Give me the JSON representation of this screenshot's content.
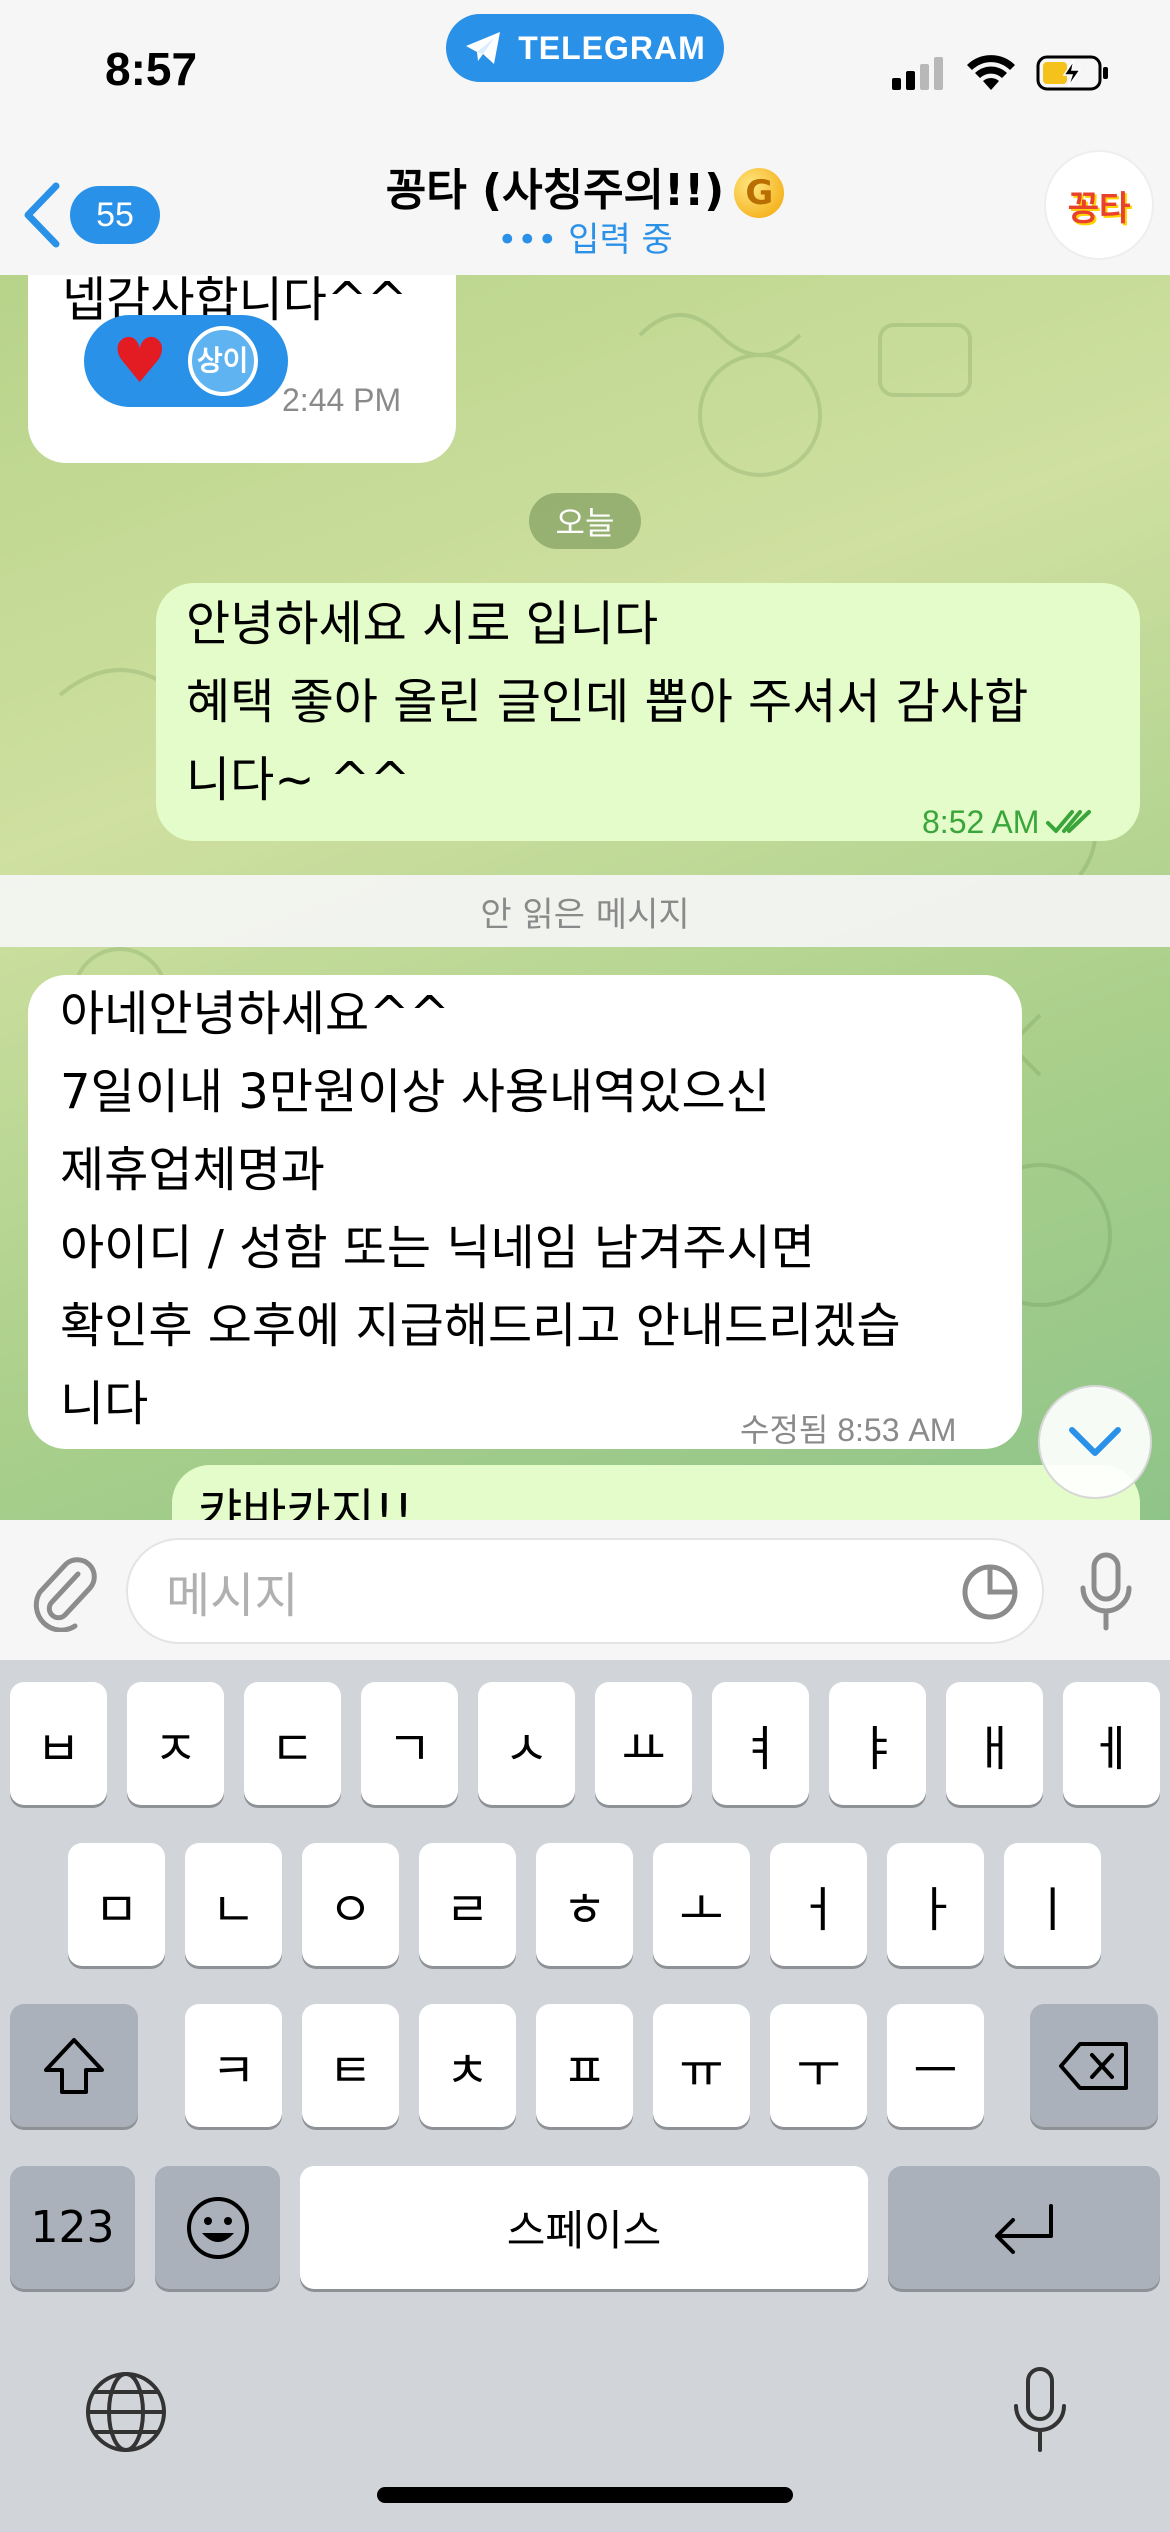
{
  "status": {
    "time": "8:57",
    "app_pill": "TELEGRAM"
  },
  "header": {
    "back_count": "55",
    "title": "꽁타 (사칭주의!!)",
    "title_badge": "G",
    "typing": "••• 입력 중",
    "avatar_text": "꽁타"
  },
  "messages": {
    "m1": {
      "text": "넵감사합니다^^",
      "time": "2:44 PM",
      "reaction_emoji": "♥",
      "reaction_user": "상이"
    },
    "date_divider": "오늘",
    "m2": {
      "lines": [
        "안녕하세요 시로 입니다",
        "혜택 좋아 올린 글인데 뽑아 주셔서 감사합",
        "니다~ ^^"
      ],
      "time": "8:52 AM"
    },
    "unread_divider": "안 읽은 메시지",
    "m3": {
      "lines": [
        "아네안녕하세요^^",
        "7일이내 3만원이상 사용내역있으신",
        "제휴업체명과",
        "아이디 / 성함 또는 닉네임 남겨주시면",
        "확인후 오후에 지급해드리고 안내드리겠습",
        "니다"
      ],
      "time": "수정됨 8:53 AM"
    },
    "m4_partial": "캬바카지!!"
  },
  "input": {
    "placeholder": "메시지"
  },
  "keyboard": {
    "row1": [
      "ㅂ",
      "ㅈ",
      "ㄷ",
      "ㄱ",
      "ㅅ",
      "ㅛ",
      "ㅕ",
      "ㅑ",
      "ㅐ",
      "ㅔ"
    ],
    "row2": [
      "ㅁ",
      "ㄴ",
      "ㅇ",
      "ㄹ",
      "ㅎ",
      "ㅗ",
      "ㅓ",
      "ㅏ",
      "ㅣ"
    ],
    "row3": [
      "ㅋ",
      "ㅌ",
      "ㅊ",
      "ㅍ",
      "ㅠ",
      "ㅜ",
      "ㅡ"
    ],
    "numbers_label": "123",
    "space_label": "스페이스"
  },
  "colors": {
    "accent": "#2a91e8",
    "outgoing_bubble": "#e3fcc9",
    "read_check": "#3aa53a"
  }
}
